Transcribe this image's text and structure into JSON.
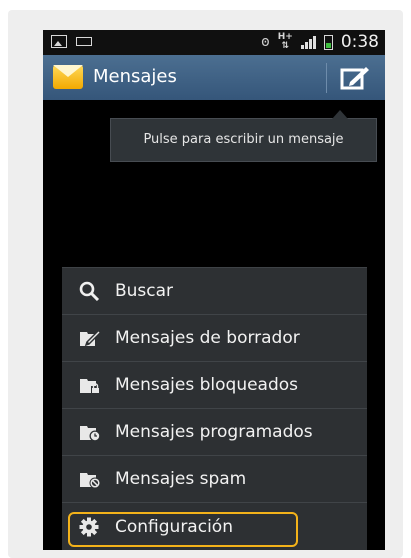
{
  "status_bar": {
    "network": "H+",
    "time": "0:38"
  },
  "action_bar": {
    "title": "Mensajes"
  },
  "tooltip": {
    "text": "Pulse para escribir un mensaje"
  },
  "menu": {
    "items": [
      {
        "label": "Buscar",
        "icon": "search-icon"
      },
      {
        "label": "Mensajes de borrador",
        "icon": "draft-folder-icon"
      },
      {
        "label": "Mensajes bloqueados",
        "icon": "locked-folder-icon"
      },
      {
        "label": "Mensajes programados",
        "icon": "scheduled-folder-icon"
      },
      {
        "label": "Mensajes spam",
        "icon": "spam-folder-icon"
      },
      {
        "label": "Configuración",
        "icon": "gear-icon"
      }
    ]
  },
  "colors": {
    "action_bar": "#3f6285",
    "menu_bg": "#2d3033",
    "highlight": "#f3b21a",
    "tooltip_bg": "#2f3438"
  }
}
